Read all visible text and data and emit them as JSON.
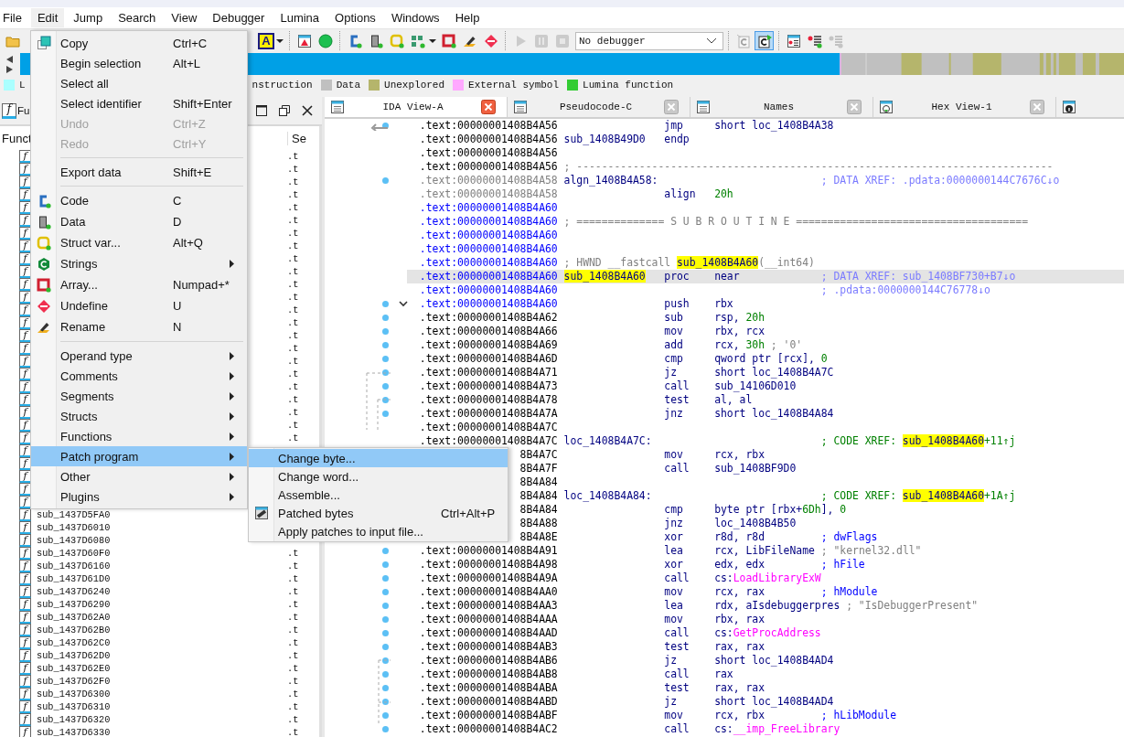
{
  "menubar": [
    {
      "label": "File",
      "selected": false
    },
    {
      "label": "Edit",
      "selected": true
    },
    {
      "label": "Jump",
      "selected": false
    },
    {
      "label": "Search",
      "selected": false
    },
    {
      "label": "View",
      "selected": false
    },
    {
      "label": "Debugger",
      "selected": false
    },
    {
      "label": "Lumina",
      "selected": false
    },
    {
      "label": "Options",
      "selected": false
    },
    {
      "label": "Windows",
      "selected": false
    },
    {
      "label": "Help",
      "selected": false
    }
  ],
  "toolbar": {
    "groups": [
      [
        {
          "kind": "icon",
          "disabled": false,
          "pressed": false
        }
      ],
      [
        {
          "kind": "text",
          "text": "A",
          "disabled": false,
          "pressed": false
        },
        {
          "kind": "caret"
        }
      ],
      [
        {
          "kind": "icon",
          "disabled": false,
          "pressed": false
        },
        {
          "kind": "icon",
          "disabled": false,
          "pressed": false
        }
      ],
      [
        {
          "kind": "icon",
          "disabled": false,
          "pressed": false
        },
        {
          "kind": "icon",
          "disabled": false,
          "pressed": false
        },
        {
          "kind": "icon",
          "disabled": false,
          "pressed": false
        },
        {
          "kind": "icon",
          "disabled": false,
          "pressed": false
        },
        {
          "kind": "caret"
        },
        {
          "kind": "icon",
          "disabled": false,
          "pressed": false
        },
        {
          "kind": "icon",
          "disabled": false,
          "pressed": false
        },
        {
          "kind": "icon",
          "disabled": false,
          "pressed": false
        }
      ],
      [
        {
          "kind": "icon",
          "disabled": true,
          "pressed": false
        },
        {
          "kind": "icon",
          "disabled": true,
          "pressed": false
        },
        {
          "kind": "icon",
          "disabled": true,
          "pressed": false
        },
        {
          "kind": "select",
          "value": "No debugger",
          "disabled": false
        }
      ],
      [
        {
          "kind": "icon",
          "disabled": true,
          "pressed": false
        },
        {
          "kind": "icon",
          "disabled": false,
          "pressed": true
        }
      ],
      [
        {
          "kind": "icon",
          "disabled": false,
          "pressed": false
        },
        {
          "kind": "icon",
          "disabled": false,
          "pressed": false
        },
        {
          "kind": "icon",
          "disabled": true,
          "pressed": false
        }
      ]
    ]
  },
  "legend": [
    {
      "label": "L",
      "color": "#aaffff"
    },
    {
      "label": "nstruction"
    },
    {
      "label": "Data",
      "color": "#c0c0c0"
    },
    {
      "label": "Unexplored",
      "color": "#b5b56c"
    },
    {
      "label": "External symbol",
      "color": "#ffa8ff"
    },
    {
      "label": "Lumina function",
      "color": "#33cc33"
    }
  ],
  "functions": {
    "tab_icon": "f",
    "tab": "Fu",
    "columns": [
      "Funct",
      "Se"
    ],
    "rows": [
      {
        "icon": "f",
        "segment": ".t"
      },
      {
        "icon": "f",
        "segment": ".t"
      },
      {
        "icon": "f",
        "segment": ".t"
      },
      {
        "icon": "f",
        "segment": ".t"
      },
      {
        "icon": "f",
        "segment": ".t"
      },
      {
        "icon": "f",
        "segment": ".t"
      },
      {
        "icon": "f",
        "segment": ".t"
      },
      {
        "icon": "f",
        "segment": ".t"
      },
      {
        "icon": "f",
        "segment": ".t"
      },
      {
        "icon": "f",
        "segment": ".t"
      },
      {
        "icon": "f",
        "segment": ".t"
      },
      {
        "icon": "f",
        "segment": ".t"
      },
      {
        "icon": "f",
        "segment": ".t"
      },
      {
        "icon": "f",
        "segment": ".t"
      },
      {
        "icon": "f",
        "segment": ".t"
      },
      {
        "icon": "f",
        "segment": ".t"
      },
      {
        "icon": "f",
        "segment": ".t"
      },
      {
        "icon": "f",
        "segment": ".t"
      },
      {
        "icon": "f",
        "segment": ".t"
      },
      {
        "icon": "f",
        "segment": ".t"
      },
      {
        "icon": "f",
        "segment": ".t"
      },
      {
        "icon": "f",
        "segment": ".t"
      },
      {
        "icon": "f",
        "segment": ".t"
      },
      {
        "icon": "f"
      },
      {
        "icon": "f"
      },
      {
        "icon": "f"
      },
      {
        "icon": "f"
      },
      {
        "icon": "f"
      },
      {
        "icon": "f",
        "name": "sub_1437D5FA0"
      },
      {
        "icon": "f",
        "name": "sub_1437D6010"
      },
      {
        "icon": "f",
        "name": "sub_1437D6080"
      },
      {
        "icon": "f",
        "name": "sub_1437D60F0",
        "segment": ".t"
      },
      {
        "icon": "f",
        "name": "sub_1437D6160",
        "segment": ".t"
      },
      {
        "icon": "f",
        "name": "sub_1437D61D0",
        "segment": ".t"
      },
      {
        "icon": "f",
        "name": "sub_1437D6240",
        "segment": ".t"
      },
      {
        "icon": "f",
        "name": "sub_1437D6290",
        "segment": ".t"
      },
      {
        "icon": "f",
        "name": "sub_1437D62A0",
        "segment": ".t"
      },
      {
        "icon": "f",
        "name": "sub_1437D62B0",
        "segment": ".t"
      },
      {
        "icon": "f",
        "name": "sub_1437D62C0",
        "segment": ".t"
      },
      {
        "icon": "f",
        "name": "sub_1437D62D0",
        "segment": ".t"
      },
      {
        "icon": "f",
        "name": "sub_1437D62E0",
        "segment": ".t"
      },
      {
        "icon": "f",
        "name": "sub_1437D62F0",
        "segment": ".t"
      },
      {
        "icon": "f",
        "name": "sub_1437D6300",
        "segment": ".t"
      },
      {
        "icon": "f",
        "name": "sub_1437D6310",
        "segment": ".t"
      },
      {
        "icon": "f",
        "name": "sub_1437D6320",
        "segment": ".t"
      },
      {
        "icon": "f",
        "name": "sub_1437D6330",
        "segment": ".t"
      }
    ]
  },
  "tabs": [
    {
      "label": "IDA View-A",
      "selected": true,
      "closable": true
    },
    {
      "label": "Pseudocode-C",
      "selected": false,
      "closable": true
    },
    {
      "label": "Names",
      "selected": false,
      "closable": true
    },
    {
      "label": "Hex View-1",
      "selected": false,
      "closable": true
    },
    {
      "selected": false,
      "closable": false
    }
  ],
  "lines": [
    {
      "addr": ".text:00000001408B4A56",
      "kind": "normal",
      "mnem": "jmp",
      "ops": [
        {
          "text": "short loc_1408B4A38",
          "kind": "plain"
        }
      ],
      "highlighted": false,
      "dot": true,
      "fold": false
    },
    {
      "addr": ".text:00000001408B4A56",
      "kind": "normal",
      "label": [
        {
          "text": "sub_1408B49D0",
          "kind": "plain"
        }
      ],
      "mnem": "endp",
      "highlighted": false,
      "dot": false,
      "fold": false
    },
    {
      "addr": ".text:00000001408B4A56",
      "kind": "normal",
      "highlighted": false,
      "dot": false,
      "fold": false
    },
    {
      "addr": ".text:00000001408B4A56",
      "kind": "normal",
      "note": [
        {
          "text": "; ----------------------------------------------------------------------------",
          "kind": "gray"
        }
      ],
      "highlighted": false,
      "dot": false,
      "fold": false
    },
    {
      "addr": ".text:00000001408B4A58",
      "kind": "gray",
      "label": [
        {
          "text": "algn_1408B4A58:",
          "kind": "plain"
        }
      ],
      "comment": [
        {
          "text": "; DATA XREF: .pdata:0000000144C7676C↓o",
          "kind": "xref"
        }
      ],
      "highlighted": false,
      "dot": true,
      "fold": false
    },
    {
      "addr": ".text:00000001408B4A58",
      "kind": "gray",
      "mnem": "align",
      "ops": [
        {
          "text": "20h",
          "kind": "num"
        }
      ],
      "highlighted": false,
      "dot": false,
      "fold": false
    },
    {
      "addr": ".text:00000001408B4A60",
      "kind": "blue",
      "highlighted": false,
      "dot": false,
      "fold": false
    },
    {
      "addr": ".text:00000001408B4A60",
      "kind": "blue",
      "note": [
        {
          "text": "; ============== S U B R O U T I N E =====================================",
          "kind": "gray"
        }
      ],
      "highlighted": false,
      "dot": false,
      "fold": false
    },
    {
      "addr": ".text:00000001408B4A60",
      "kind": "blue",
      "highlighted": false,
      "dot": false,
      "fold": false
    },
    {
      "addr": ".text:00000001408B4A60",
      "kind": "blue",
      "highlighted": false,
      "dot": false,
      "fold": false
    },
    {
      "addr": ".text:00000001408B4A60",
      "kind": "blue",
      "note": [
        {
          "text": "; HWND __fastcall ",
          "kind": "gray"
        },
        {
          "text": "sub_1408B4A60",
          "kind": "hl"
        },
        {
          "text": "(__int64)",
          "kind": "gray"
        }
      ],
      "highlighted": false,
      "dot": false,
      "fold": false
    },
    {
      "addr": ".text:00000001408B4A60",
      "kind": "blue",
      "label": [
        {
          "text": "sub_1408B4A60",
          "kind": "hl"
        }
      ],
      "mnem": "proc",
      "ops": [
        {
          "text": "near",
          "kind": "plain"
        }
      ],
      "comment": [
        {
          "text": "; DATA XREF: sub_1408BF730+B7↓o",
          "kind": "xref"
        }
      ],
      "highlighted": true,
      "dot": false,
      "fold": false
    },
    {
      "addr": ".text:00000001408B4A60",
      "kind": "blue",
      "comment": [
        {
          "text": "; .pdata:0000000144C76778↓o",
          "kind": "xref"
        }
      ],
      "highlighted": false,
      "dot": false,
      "fold": false
    },
    {
      "addr": ".text:00000001408B4A60",
      "kind": "blue",
      "mnem": "push",
      "ops": [
        {
          "text": "rbx",
          "kind": "plain"
        }
      ],
      "highlighted": false,
      "dot": true,
      "fold": true
    },
    {
      "addr": ".text:00000001408B4A62",
      "kind": "normal",
      "mnem": "sub",
      "ops": [
        {
          "text": "rsp, ",
          "kind": "plain"
        },
        {
          "text": "20h",
          "kind": "num"
        }
      ],
      "highlighted": false,
      "dot": true,
      "fold": false
    },
    {
      "addr": ".text:00000001408B4A66",
      "kind": "normal",
      "mnem": "mov",
      "ops": [
        {
          "text": "rbx, rcx",
          "kind": "plain"
        }
      ],
      "highlighted": false,
      "dot": true,
      "fold": false
    },
    {
      "addr": ".text:00000001408B4A69",
      "kind": "normal",
      "mnem": "add",
      "ops": [
        {
          "text": "rcx, ",
          "kind": "plain"
        },
        {
          "text": "30h",
          "kind": "num"
        },
        {
          "text": " ; '0'",
          "kind": "gray"
        }
      ],
      "highlighted": false,
      "dot": true,
      "fold": false
    },
    {
      "addr": ".text:00000001408B4A6D",
      "kind": "normal",
      "mnem": "cmp",
      "ops": [
        {
          "text": "qword ptr [rcx], ",
          "kind": "plain"
        },
        {
          "text": "0",
          "kind": "num"
        }
      ],
      "highlighted": false,
      "dot": true,
      "fold": false
    },
    {
      "addr": ".text:00000001408B4A71",
      "kind": "normal",
      "mnem": "jz",
      "ops": [
        {
          "text": "short loc_1408B4A7C",
          "kind": "plain"
        }
      ],
      "highlighted": false,
      "dot": true,
      "fold": false
    },
    {
      "addr": ".text:00000001408B4A73",
      "kind": "normal",
      "mnem": "call",
      "ops": [
        {
          "text": "sub_14106D010",
          "kind": "plain"
        }
      ],
      "highlighted": false,
      "dot": true,
      "fold": false
    },
    {
      "addr": ".text:00000001408B4A78",
      "kind": "normal",
      "mnem": "test",
      "ops": [
        {
          "text": "al, al",
          "kind": "plain"
        }
      ],
      "highlighted": false,
      "dot": true,
      "fold": false
    },
    {
      "addr": ".text:00000001408B4A7A",
      "kind": "normal",
      "mnem": "jnz",
      "ops": [
        {
          "text": "short loc_1408B4A84",
          "kind": "plain"
        }
      ],
      "highlighted": false,
      "dot": true,
      "fold": false
    },
    {
      "addr": ".text:00000001408B4A7C",
      "kind": "normal",
      "highlighted": false,
      "dot": false,
      "fold": false
    },
    {
      "addr": ".text:00000001408B4A7C",
      "kind": "normal",
      "label": [
        {
          "text": "loc_1408B4A7C:",
          "kind": "plain"
        }
      ],
      "comment": [
        {
          "text": "; CODE XREF: ",
          "kind": "cxref"
        },
        {
          "text": "sub_1408B4A60",
          "kind": "hl"
        },
        {
          "text": "+11↑j",
          "kind": "cxref"
        }
      ],
      "highlighted": false,
      "dot": false,
      "fold": false
    },
    {
      "addr": "8B4A7C",
      "kind": "normal",
      "mnem": "mov",
      "ops": [
        {
          "text": "rcx, rbx",
          "kind": "plain"
        }
      ],
      "highlighted": false,
      "dot": false,
      "fold": false
    },
    {
      "addr": "8B4A7F",
      "kind": "normal",
      "mnem": "call",
      "ops": [
        {
          "text": "sub_1408BF9D0",
          "kind": "plain"
        }
      ],
      "highlighted": false,
      "dot": false,
      "fold": false
    },
    {
      "addr": "8B4A84",
      "kind": "normal",
      "highlighted": false,
      "dot": false,
      "fold": false
    },
    {
      "addr": "8B4A84",
      "kind": "normal",
      "label": [
        {
          "text": "loc_1408B4A84:",
          "kind": "plain"
        }
      ],
      "comment": [
        {
          "text": "; CODE XREF: ",
          "kind": "cxref"
        },
        {
          "text": "sub_1408B4A60",
          "kind": "hl"
        },
        {
          "text": "+1A↑j",
          "kind": "cxref"
        }
      ],
      "highlighted": false,
      "dot": false,
      "fold": false
    },
    {
      "addr": "8B4A84",
      "kind": "normal",
      "mnem": "cmp",
      "ops": [
        {
          "text": "byte ptr [rbx+",
          "kind": "plain"
        },
        {
          "text": "6Dh",
          "kind": "num"
        },
        {
          "text": "], ",
          "kind": "plain"
        },
        {
          "text": "0",
          "kind": "num"
        }
      ],
      "highlighted": false,
      "dot": false,
      "fold": false
    },
    {
      "addr": "8B4A88",
      "kind": "normal",
      "mnem": "jnz",
      "ops": [
        {
          "text": "loc_1408B4B50",
          "kind": "plain"
        }
      ],
      "highlighted": false,
      "dot": false,
      "fold": false
    },
    {
      "addr": "8B4A8E",
      "kind": "normal",
      "mnem": "xor",
      "ops": [
        {
          "text": "r8d, r8d",
          "kind": "plain"
        }
      ],
      "comment": [
        {
          "text": "; dwFlags",
          "kind": "arg"
        }
      ],
      "highlighted": false,
      "dot": false,
      "fold": false
    },
    {
      "addr": ".text:00000001408B4A91",
      "kind": "normal",
      "mnem": "lea",
      "ops": [
        {
          "text": "rcx, LibFileName",
          "kind": "plain"
        },
        {
          "text": " ; \"kernel32.dll\"",
          "kind": "gray"
        }
      ],
      "highlighted": false,
      "dot": true,
      "fold": false
    },
    {
      "addr": ".text:00000001408B4A98",
      "kind": "normal",
      "mnem": "xor",
      "ops": [
        {
          "text": "edx, edx",
          "kind": "plain"
        }
      ],
      "comment": [
        {
          "text": "; hFile",
          "kind": "arg"
        }
      ],
      "highlighted": false,
      "dot": true,
      "fold": false
    },
    {
      "addr": ".text:00000001408B4A9A",
      "kind": "normal",
      "mnem": "call",
      "ops": [
        {
          "text": "cs:",
          "kind": "plain"
        },
        {
          "text": "LoadLibraryExW",
          "kind": "imp"
        }
      ],
      "highlighted": false,
      "dot": true,
      "fold": false
    },
    {
      "addr": ".text:00000001408B4AA0",
      "kind": "normal",
      "mnem": "mov",
      "ops": [
        {
          "text": "rcx, rax",
          "kind": "plain"
        }
      ],
      "comment": [
        {
          "text": "; hModule",
          "kind": "arg"
        }
      ],
      "highlighted": false,
      "dot": true,
      "fold": false
    },
    {
      "addr": ".text:00000001408B4AA3",
      "kind": "normal",
      "mnem": "lea",
      "ops": [
        {
          "text": "rdx, aIsdebuggerpres",
          "kind": "plain"
        },
        {
          "text": " ; \"IsDebuggerPresent\"",
          "kind": "gray"
        }
      ],
      "highlighted": false,
      "dot": true,
      "fold": false
    },
    {
      "addr": ".text:00000001408B4AAA",
      "kind": "normal",
      "mnem": "mov",
      "ops": [
        {
          "text": "rbx, rax",
          "kind": "plain"
        }
      ],
      "highlighted": false,
      "dot": true,
      "fold": false
    },
    {
      "addr": ".text:00000001408B4AAD",
      "kind": "normal",
      "mnem": "call",
      "ops": [
        {
          "text": "cs:",
          "kind": "plain"
        },
        {
          "text": "GetProcAddress",
          "kind": "imp"
        }
      ],
      "highlighted": false,
      "dot": true,
      "fold": false
    },
    {
      "addr": ".text:00000001408B4AB3",
      "kind": "normal",
      "mnem": "test",
      "ops": [
        {
          "text": "rax, rax",
          "kind": "plain"
        }
      ],
      "highlighted": false,
      "dot": true,
      "fold": false
    },
    {
      "addr": ".text:00000001408B4AB6",
      "kind": "normal",
      "mnem": "jz",
      "ops": [
        {
          "text": "short loc_1408B4AD4",
          "kind": "plain"
        }
      ],
      "highlighted": false,
      "dot": true,
      "fold": false
    },
    {
      "addr": ".text:00000001408B4AB8",
      "kind": "normal",
      "mnem": "call",
      "ops": [
        {
          "text": "rax",
          "kind": "plain"
        }
      ],
      "highlighted": false,
      "dot": true,
      "fold": false
    },
    {
      "addr": ".text:00000001408B4ABA",
      "kind": "normal",
      "mnem": "test",
      "ops": [
        {
          "text": "rax, rax",
          "kind": "plain"
        }
      ],
      "highlighted": false,
      "dot": true,
      "fold": false
    },
    {
      "addr": ".text:00000001408B4ABD",
      "kind": "normal",
      "mnem": "jz",
      "ops": [
        {
          "text": "short loc_1408B4AD4",
          "kind": "plain"
        }
      ],
      "highlighted": false,
      "dot": true,
      "fold": false
    },
    {
      "addr": ".text:00000001408B4ABF",
      "kind": "normal",
      "mnem": "mov",
      "ops": [
        {
          "text": "rcx, rbx",
          "kind": "plain"
        }
      ],
      "comment": [
        {
          "text": "; hLibModule",
          "kind": "arg"
        }
      ],
      "highlighted": false,
      "dot": true,
      "fold": false
    },
    {
      "addr": ".text:00000001408B4AC2",
      "kind": "normal",
      "mnem": "call",
      "ops": [
        {
          "text": "cs:",
          "kind": "plain"
        },
        {
          "text": "__imp_FreeLibrary",
          "kind": "imp"
        }
      ],
      "highlighted": false,
      "dot": true,
      "fold": false
    }
  ],
  "edit_menu": [
    {
      "kind": "item",
      "label": "Copy",
      "shortcut": "Ctrl+C",
      "selected": false,
      "disabled": false,
      "submenu": false
    },
    {
      "kind": "item",
      "label": "Begin selection",
      "shortcut": "Alt+L",
      "selected": false,
      "disabled": false,
      "submenu": false
    },
    {
      "kind": "item",
      "label": "Select all",
      "selected": false,
      "disabled": false,
      "submenu": false
    },
    {
      "kind": "item",
      "label": "Select identifier",
      "shortcut": "Shift+Enter",
      "selected": false,
      "disabled": false,
      "submenu": false
    },
    {
      "kind": "item",
      "label": "Undo",
      "shortcut": "Ctrl+Z",
      "selected": false,
      "disabled": true,
      "submenu": false
    },
    {
      "kind": "item",
      "label": "Redo",
      "shortcut": "Ctrl+Y",
      "selected": false,
      "disabled": true,
      "submenu": false
    },
    {
      "kind": "separator"
    },
    {
      "kind": "item",
      "label": "Export data",
      "shortcut": "Shift+E",
      "selected": false,
      "disabled": false,
      "submenu": false
    },
    {
      "kind": "separator"
    },
    {
      "kind": "item",
      "label": "Code",
      "shortcut": "C",
      "selected": false,
      "disabled": false,
      "submenu": false
    },
    {
      "kind": "item",
      "label": "Data",
      "shortcut": "D",
      "selected": false,
      "disabled": false,
      "submenu": false
    },
    {
      "kind": "item",
      "label": "Struct var...",
      "shortcut": "Alt+Q",
      "selected": false,
      "disabled": false,
      "submenu": false
    },
    {
      "kind": "item",
      "label": "Strings",
      "selected": false,
      "disabled": false,
      "submenu": true
    },
    {
      "kind": "item",
      "label": "Array...",
      "shortcut": "Numpad+*",
      "selected": false,
      "disabled": false,
      "submenu": false
    },
    {
      "kind": "item",
      "label": "Undefine",
      "shortcut": "U",
      "selected": false,
      "disabled": false,
      "submenu": false
    },
    {
      "kind": "item",
      "label": "Rename",
      "shortcut": "N",
      "selected": false,
      "disabled": false,
      "submenu": false
    },
    {
      "kind": "separator"
    },
    {
      "kind": "item",
      "label": "Operand type",
      "selected": false,
      "disabled": false,
      "submenu": true
    },
    {
      "kind": "item",
      "label": "Comments",
      "selected": false,
      "disabled": false,
      "submenu": true
    },
    {
      "kind": "item",
      "label": "Segments",
      "selected": false,
      "disabled": false,
      "submenu": true
    },
    {
      "kind": "item",
      "label": "Structs",
      "selected": false,
      "disabled": false,
      "submenu": true
    },
    {
      "kind": "item",
      "label": "Functions",
      "selected": false,
      "disabled": false,
      "submenu": true
    },
    {
      "kind": "item",
      "label": "Patch program",
      "selected": true,
      "disabled": false,
      "submenu": true
    },
    {
      "kind": "item",
      "label": "Other",
      "selected": false,
      "disabled": false,
      "submenu": true
    },
    {
      "kind": "item",
      "label": "Plugins",
      "selected": false,
      "disabled": false,
      "submenu": true
    }
  ],
  "patch_menu": [
    {
      "label": "Change byte...",
      "selected": true,
      "disabled": false
    },
    {
      "label": "Change word...",
      "selected": false,
      "disabled": false
    },
    {
      "label": "Assemble...",
      "selected": false,
      "disabled": false
    },
    {
      "label": "Patched bytes",
      "shortcut": "Ctrl+Alt+P",
      "selected": false,
      "disabled": false
    },
    {
      "label": "Apply patches to input file...",
      "selected": false,
      "disabled": false
    }
  ]
}
